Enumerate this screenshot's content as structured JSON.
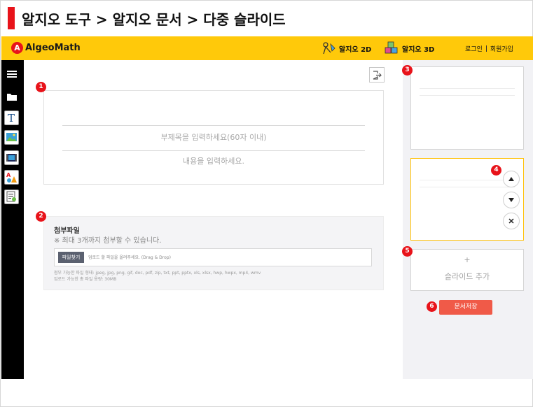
{
  "page_title": "알지오 도구 > 알지오 문서 > 다중 슬라이드",
  "header": {
    "logo_mark": "A",
    "logo_text": "AlgeoMath",
    "nav_2d": "알지오 2D",
    "nav_3d": "알지오 3D",
    "login": "로그인",
    "signup": "회원가입",
    "accent_color": "#ffc90a"
  },
  "toolbar": {
    "icons": [
      "menu-icon",
      "folder-icon",
      "text-tool-icon",
      "image-tool-icon",
      "video-tool-icon",
      "algeo-tool-icon",
      "document-tool-icon"
    ]
  },
  "editor": {
    "subtitle_placeholder": "부제목을 입력하세요(60자 이내)",
    "content_placeholder": "내용을 입력하세요."
  },
  "attachment": {
    "title": "첨부파일",
    "limit_note": "※ 최대 3개까지 첨부할 수 있습니다.",
    "find_button": "파일찾기",
    "upload_placeholder": "업로드 할 파일을 올려주세요. (Drag & Drop)",
    "allowed_types": "첨부 가능한 파일 형태: jpeg, jpg, png, gif, doc, pdf, zip, txt, ppt, pptx, xls, xlsx, hwp, hwpx, mp4, wmv",
    "size_limit": "업로드 가능한 총 파일 용량: 30MB"
  },
  "slides": {
    "add_plus": "+",
    "add_label": "슬라이드 추가",
    "save_button": "문서저장"
  },
  "markers": [
    "1",
    "2",
    "3",
    "4",
    "5",
    "6"
  ]
}
